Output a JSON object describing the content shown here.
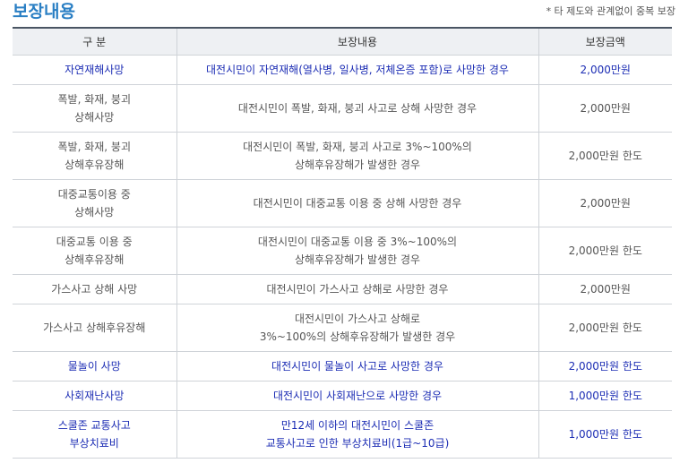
{
  "title": "보장내용",
  "note": "* 타 제도와 관계없이 중복 보장",
  "headers": {
    "category": "구 분",
    "content": "보장내용",
    "amount": "보장금액"
  },
  "rows": [
    {
      "category": [
        "자연재해사망"
      ],
      "content": [
        "대전시민이 자연재해(열사병, 일사병, 저체온증 포함)로 사망한 경우"
      ],
      "amount": "2,000만원"
    },
    {
      "category": [
        "폭발, 화재, 붕괴",
        "상해사망"
      ],
      "content": [
        "대전시민이 폭발, 화재, 붕괴 사고로 상해 사망한 경우"
      ],
      "amount": "2,000만원"
    },
    {
      "category": [
        "폭발, 화재, 붕괴",
        "상해후유장해"
      ],
      "content": [
        "대전시민이 폭발, 화재, 붕괴 사고로 3%~100%의",
        "상해후유장해가 발생한 경우"
      ],
      "amount": "2,000만원 한도"
    },
    {
      "category": [
        "대중교통이용 중",
        "상해사망"
      ],
      "content": [
        "대전시민이 대중교통 이용 중 상해 사망한 경우"
      ],
      "amount": "2,000만원"
    },
    {
      "category": [
        "대중교통 이용 중",
        "상해후유장해"
      ],
      "content": [
        "대전시민이 대중교통 이용 중 3%~100%의",
        "상해후유장해가 발생한 경우"
      ],
      "amount": "2,000만원 한도"
    },
    {
      "category": [
        "가스사고 상해 사망"
      ],
      "content": [
        "대전시민이 가스사고 상해로 사망한 경우"
      ],
      "amount": "2,000만원"
    },
    {
      "category": [
        "가스사고 상해후유장해"
      ],
      "content": [
        "대전시민이 가스사고 상해로",
        "3%~100%의 상해후유장해가 발생한 경우"
      ],
      "amount": "2,000만원 한도"
    },
    {
      "category": [
        "물놀이 사망"
      ],
      "content": [
        "대전시민이 물놀이 사고로 사망한 경우"
      ],
      "amount": "2,000만원 한도"
    },
    {
      "category": [
        "사회재난사망"
      ],
      "content": [
        "대전시민이 사회재난으로 사망한 경우"
      ],
      "amount": "1,000만원 한도"
    },
    {
      "category": [
        "스쿨존 교통사고",
        "부상치료비"
      ],
      "content": [
        "만12세 이하의 대전시민이 스쿨존",
        "교통사고로 인한 부상치료비(1급~10급)"
      ],
      "amount": "1,000만원 한도"
    }
  ]
}
